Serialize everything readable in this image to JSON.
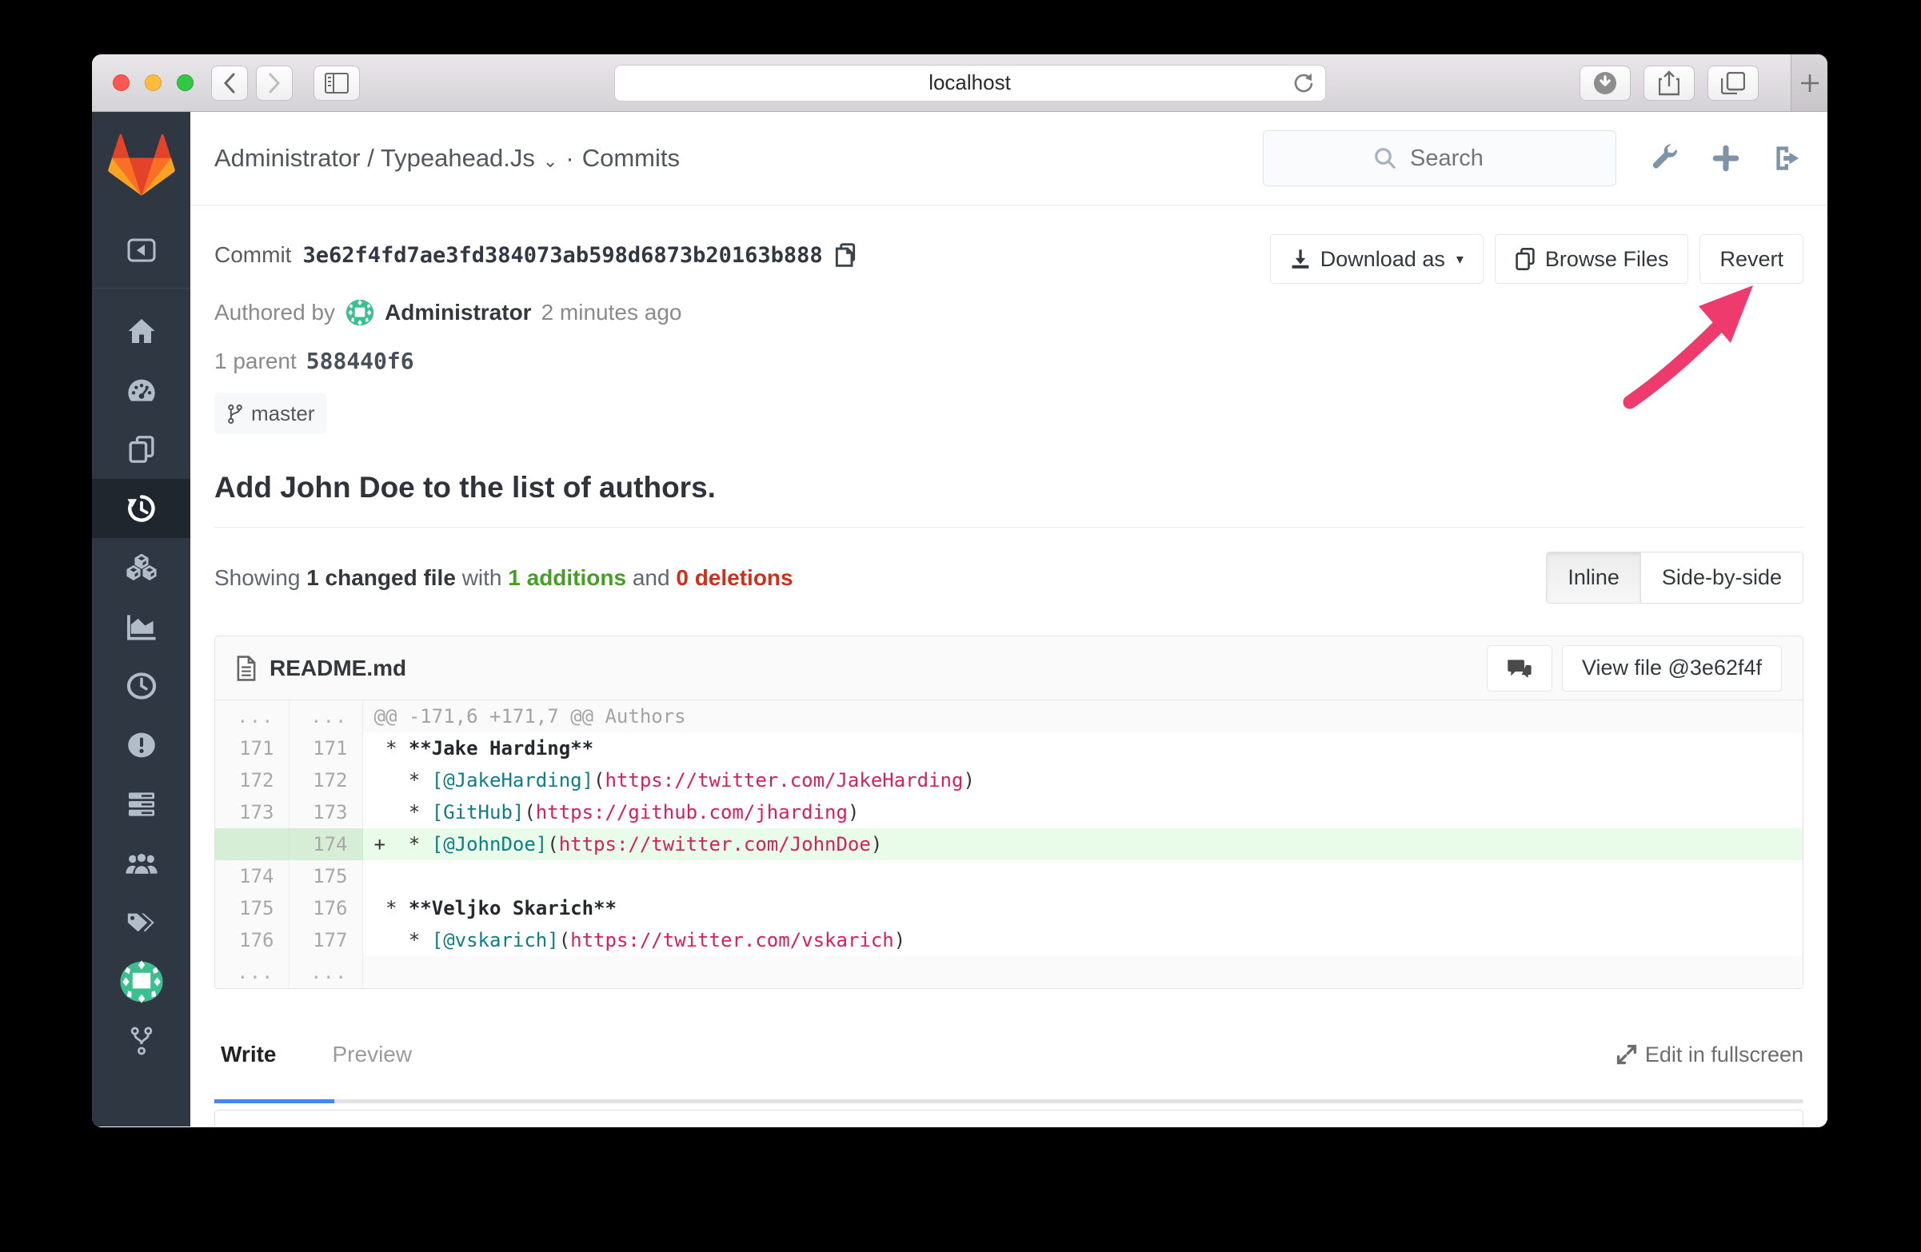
{
  "browser": {
    "url": "localhost",
    "controls": [
      "close",
      "minimize",
      "zoom"
    ],
    "toolbar": [
      "back",
      "forward",
      "sidebar-toggle",
      "reload",
      "downloads",
      "share",
      "tab-overview",
      "new-tab"
    ]
  },
  "gitlab_header": {
    "project_breadcrumb": "Administrator / Typeahead.Js",
    "section": "Commits",
    "separator": "·",
    "search_placeholder": "Search",
    "icons": [
      "search-icon",
      "wrench-icon",
      "plus-icon",
      "sign-out-icon"
    ]
  },
  "sidebar": {
    "items": [
      {
        "icon": "collapse-sidebar-icon",
        "active": false
      },
      {
        "icon": "home-icon",
        "active": false
      },
      {
        "icon": "dashboard-icon",
        "active": false
      },
      {
        "icon": "files-icon",
        "active": false
      },
      {
        "icon": "history-icon",
        "active": true
      },
      {
        "icon": "builds-icon",
        "active": false
      },
      {
        "icon": "graphs-icon",
        "active": false
      },
      {
        "icon": "clock-icon",
        "active": false
      },
      {
        "icon": "issues-icon",
        "active": false
      },
      {
        "icon": "merge-requests-icon",
        "active": false
      },
      {
        "icon": "members-icon",
        "active": false
      },
      {
        "icon": "labels-icon",
        "active": false
      },
      {
        "icon": "project-avatar",
        "active": false
      },
      {
        "icon": "network-icon",
        "active": false
      }
    ]
  },
  "commit": {
    "label": "Commit",
    "sha": "3e62f4fd7ae3fd384073ab598d6873b20163b888",
    "authored_prefix": "Authored by",
    "author": "Administrator",
    "authored_time": "2 minutes ago",
    "parent_label": "1 parent",
    "parent_sha": "588440f6",
    "branch": "master",
    "title": "Add John Doe to the list of authors.",
    "download_button": "Download as",
    "browse_button": "Browse Files",
    "revert_button": "Revert"
  },
  "changes": {
    "showing": "Showing",
    "changed_file": "1 changed file",
    "with": "with",
    "additions": "1 additions",
    "and": "and",
    "deletions": "0 deletions",
    "inline_toggle": "Inline",
    "side_by_side_toggle": "Side-by-side"
  },
  "diff": {
    "file_name": "README.md",
    "view_file_button": "View file @3e62f4f",
    "rows": [
      {
        "old": "...",
        "new": "...",
        "type": "match",
        "segments": [
          {
            "c": "hunk",
            "t": "@@ -171,6 +171,7 @@ Authors"
          }
        ]
      },
      {
        "old": "171",
        "new": "171",
        "type": "context",
        "segments": [
          {
            "c": "plain",
            "t": " * "
          },
          {
            "c": "bold",
            "t": "**Jake Harding**"
          }
        ]
      },
      {
        "old": "172",
        "new": "172",
        "type": "context",
        "segments": [
          {
            "c": "plain",
            "t": "   * "
          },
          {
            "c": "link",
            "t": "[@JakeHarding]"
          },
          {
            "c": "plain",
            "t": "("
          },
          {
            "c": "url",
            "t": "https://twitter.com/JakeHarding"
          },
          {
            "c": "plain",
            "t": ")"
          }
        ]
      },
      {
        "old": "173",
        "new": "173",
        "type": "context",
        "segments": [
          {
            "c": "plain",
            "t": "   * "
          },
          {
            "c": "link",
            "t": "[GitHub]"
          },
          {
            "c": "plain",
            "t": "("
          },
          {
            "c": "url",
            "t": "https://github.com/jharding"
          },
          {
            "c": "plain",
            "t": ")"
          }
        ]
      },
      {
        "old": "",
        "new": "174",
        "type": "add",
        "segments": [
          {
            "c": "plain",
            "t": "+  * "
          },
          {
            "c": "link",
            "t": "[@JohnDoe]"
          },
          {
            "c": "plain",
            "t": "("
          },
          {
            "c": "url",
            "t": "https://twitter.com/JohnDoe"
          },
          {
            "c": "plain",
            "t": ")"
          }
        ]
      },
      {
        "old": "174",
        "new": "175",
        "type": "context",
        "segments": []
      },
      {
        "old": "175",
        "new": "176",
        "type": "context",
        "segments": [
          {
            "c": "plain",
            "t": " * "
          },
          {
            "c": "bold",
            "t": "**Veljko Skarich**"
          }
        ]
      },
      {
        "old": "176",
        "new": "177",
        "type": "context",
        "segments": [
          {
            "c": "plain",
            "t": "   * "
          },
          {
            "c": "link",
            "t": "[@vskarich]"
          },
          {
            "c": "plain",
            "t": "("
          },
          {
            "c": "url",
            "t": "https://twitter.com/vskarich"
          },
          {
            "c": "plain",
            "t": ")"
          }
        ]
      },
      {
        "old": "...",
        "new": "...",
        "type": "match",
        "segments": []
      }
    ]
  },
  "editor": {
    "write_tab": "Write",
    "preview_tab": "Preview",
    "fullscreen_link": "Edit in fullscreen"
  },
  "colors": {
    "sidebar_bg": "#2e3742",
    "additions_green": "#44a022",
    "deletions_red": "#d22f19",
    "diff_added_bg": "#e9fbe9",
    "code_link_teal": "#0d7e83",
    "code_url_crimson": "#d6205c",
    "revert_arrow_pink": "#ee3a6c",
    "active_tab_blue": "#4285f4",
    "logo_orange_dark": "#e24329",
    "logo_orange": "#fc6d26",
    "logo_orange_light": "#fca326",
    "avatar_teal": "#3cbf8f"
  }
}
